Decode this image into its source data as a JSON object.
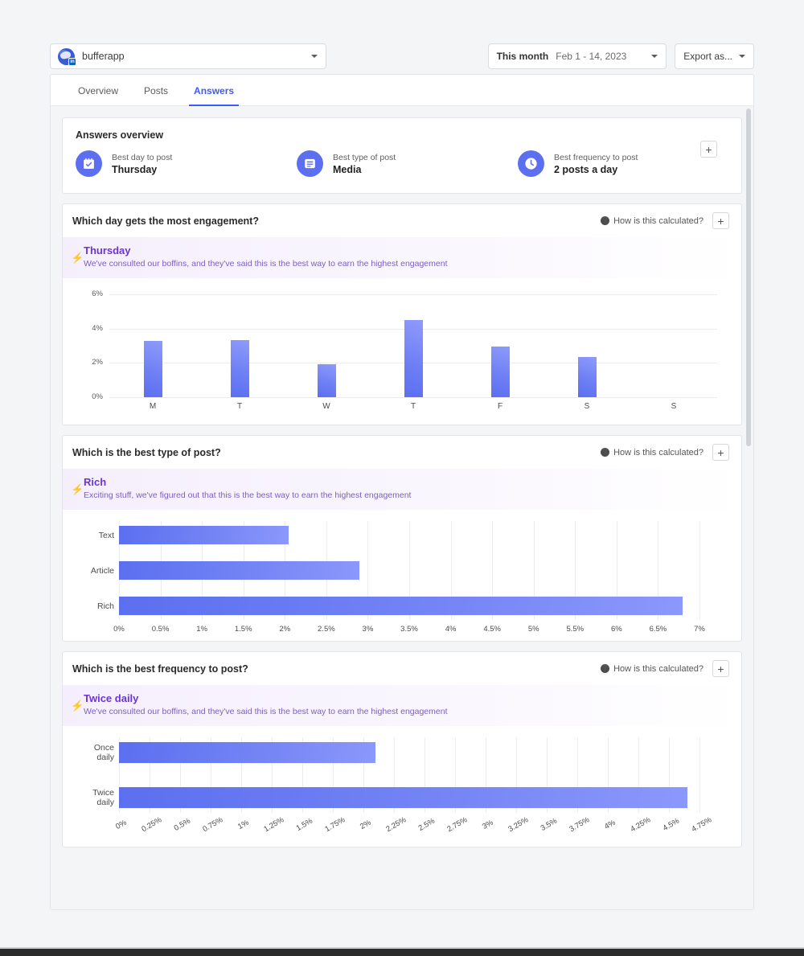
{
  "topbar": {
    "account_name": "bufferapp",
    "account_badge": "in",
    "date_range_label": "This month",
    "date_range_value": "Feb 1 - 14, 2023",
    "export_label": "Export as...",
    "caret_icon": "chevron-down-icon"
  },
  "tabs": [
    {
      "label": "Overview",
      "active": false
    },
    {
      "label": "Posts",
      "active": false
    },
    {
      "label": "Answers",
      "active": true
    }
  ],
  "overview": {
    "title": "Answers overview",
    "add_label": "+",
    "items": [
      {
        "icon": "calendar-check-icon",
        "sub": "Best day to post",
        "value": "Thursday"
      },
      {
        "icon": "media-post-icon",
        "sub": "Best type of post",
        "value": "Media"
      },
      {
        "icon": "clock-icon",
        "sub": "Best frequency to post",
        "value": "2 posts a day"
      }
    ]
  },
  "how_calculated_label": "How is this calculated?",
  "add_label": "+",
  "sections": [
    {
      "title": "Which day gets the most engagement?",
      "banner_title": "Thursday",
      "banner_sub": "We've consulted our boffins, and they've said this is the best way to earn the highest engagement"
    },
    {
      "title": "Which is the best type of post?",
      "banner_title": "Rich",
      "banner_sub": "Exciting stuff, we've figured out that this is the best way to earn the highest engagement"
    },
    {
      "title": "Which is the best frequency to post?",
      "banner_title": "Twice daily",
      "banner_sub": "We've consulted our boffins, and they've said this is the best way to earn the highest engagement"
    }
  ],
  "chart_data": [
    {
      "type": "bar",
      "orientation": "vertical",
      "title": "Which day gets the most engagement?",
      "categories": [
        "M",
        "T",
        "W",
        "T",
        "F",
        "S",
        "S"
      ],
      "values": [
        3.3,
        3.35,
        1.9,
        4.5,
        2.95,
        2.35,
        0
      ],
      "ylabel": "",
      "xlabel": "",
      "ylim": [
        0,
        6
      ],
      "yticks": [
        "0%",
        "2%",
        "4%",
        "6%"
      ],
      "ytick_values": [
        0,
        2,
        4,
        6
      ],
      "grid": true,
      "legend": false,
      "bar_color": "#6b7cf3"
    },
    {
      "type": "bar",
      "orientation": "horizontal",
      "title": "Which is the best type of post?",
      "categories": [
        "Text",
        "Article",
        "Rich"
      ],
      "values": [
        2.05,
        2.9,
        6.8
      ],
      "xlim": [
        0,
        7
      ],
      "xticks": [
        "0%",
        "0.5%",
        "1%",
        "1.5%",
        "2%",
        "2.5%",
        "3%",
        "3.5%",
        "4%",
        "4.5%",
        "5%",
        "5.5%",
        "6%",
        "6.5%",
        "7%"
      ],
      "xtick_values": [
        0,
        0.5,
        1,
        1.5,
        2,
        2.5,
        3,
        3.5,
        4,
        4.5,
        5,
        5.5,
        6,
        6.5,
        7
      ],
      "grid": true,
      "legend": false,
      "bar_color": "#6b7cf3"
    },
    {
      "type": "bar",
      "orientation": "horizontal",
      "title": "Which is the best frequency to post?",
      "categories": [
        "Once daily",
        "Twice daily"
      ],
      "values": [
        2.1,
        4.65
      ],
      "xlim": [
        0,
        5
      ],
      "xticks": [
        "0%",
        "0.25%",
        "0.5%",
        "0.75%",
        "1%",
        "1.25%",
        "1.5%",
        "1.75%",
        "2%",
        "2.25%",
        "2.5%",
        "2.75%",
        "3%",
        "3.25%",
        "3.5%",
        "3.75%",
        "4%",
        "4.25%",
        "4.5%",
        "4.75%"
      ],
      "xtick_values": [
        0,
        0.25,
        0.5,
        0.75,
        1,
        1.25,
        1.5,
        1.75,
        2,
        2.25,
        2.5,
        2.75,
        3,
        3.25,
        3.5,
        3.75,
        4,
        4.25,
        4.5,
        4.75
      ],
      "grid": true,
      "legend": false,
      "bar_color": "#6b7cf3"
    }
  ]
}
